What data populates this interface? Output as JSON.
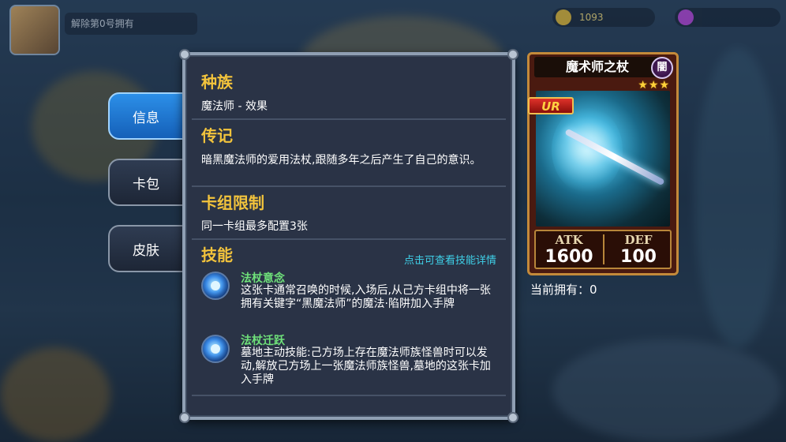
{
  "background": {
    "player_name": "解除第0号拥有",
    "resource_1_value": "1093",
    "resource_2_value": ""
  },
  "tabs": [
    {
      "label": "信息",
      "active": true
    },
    {
      "label": "卡包",
      "active": false
    },
    {
      "label": "皮肤",
      "active": false
    }
  ],
  "panel": {
    "race_title": "种族",
    "race_text": "魔法师 - 效果",
    "bio_title": "传记",
    "bio_text": "暗黑魔法师的爱用法杖,跟随多年之后产生了自己的意识。",
    "limit_title": "卡组限制",
    "limit_text": "同一卡组最多配置3张",
    "skills_title": "技能",
    "skills_link": "点击可查看技能详情",
    "skills": [
      {
        "name": "法杖意念",
        "description": "这张卡通常召唤的时候,入场后,从己方卡组中将一张拥有关键字“黑魔法师”的魔法·陷阱加入手牌",
        "icon": "magic-orb-icon"
      },
      {
        "name": "法杖迁跃",
        "description": "墓地主动技能:己方场上存在魔法师族怪兽时可以发动,解放己方场上一张魔法师族怪兽,墓地的这张卡加入手牌",
        "icon": "magic-orb-icon"
      }
    ]
  },
  "card": {
    "name": "魔术师之杖",
    "attribute": "闇",
    "stars": "★★★",
    "rarity": "UR",
    "atk_label": "ATK",
    "atk_value": "1600",
    "def_label": "DEF",
    "def_value": "100"
  },
  "owned_text": "当前拥有：0",
  "colors": {
    "section_title": "#f2c33c",
    "skill_name": "#6fe27a",
    "link": "#3fd0e8",
    "active_tab": "#2c8fe8"
  }
}
